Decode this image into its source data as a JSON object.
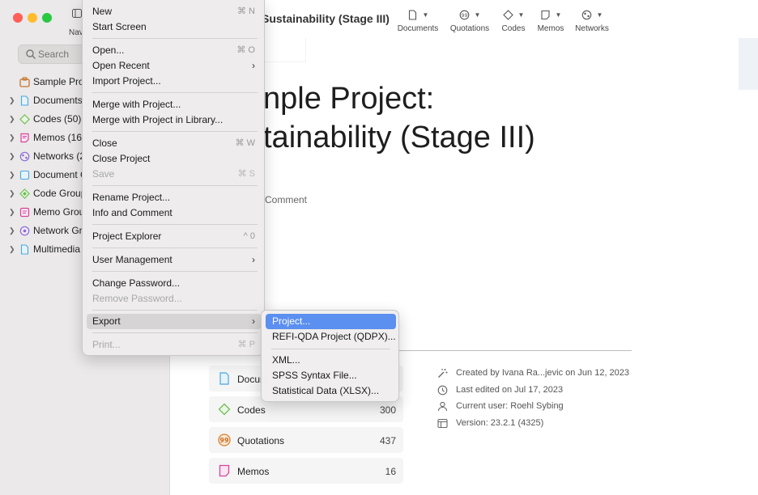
{
  "sidebar": {
    "nav_label": "Navi",
    "search_placeholder": "Search",
    "items": [
      {
        "label": "Sample Pro",
        "icon": "project-icon",
        "color": "#c8742c"
      },
      {
        "label": "Documents",
        "icon": "document-icon",
        "color": "#4aa8e0"
      },
      {
        "label": "Codes (50)",
        "icon": "code-icon",
        "color": "#6cbf4f"
      },
      {
        "label": "Memos (16)",
        "icon": "memo-icon",
        "color": "#d6449a"
      },
      {
        "label": "Networks (2",
        "icon": "network-icon",
        "color": "#8a6ad6"
      },
      {
        "label": "Document G",
        "icon": "document-group-icon",
        "color": "#4aa8e0"
      },
      {
        "label": "Code Group",
        "icon": "code-group-icon",
        "color": "#6cbf4f"
      },
      {
        "label": "Memo Grou",
        "icon": "memo-group-icon",
        "color": "#d6449a"
      },
      {
        "label": "Network Gr",
        "icon": "network-group-icon",
        "color": "#8a6ad6"
      },
      {
        "label": "Multimedia",
        "icon": "multimedia-icon",
        "color": "#4aa8e0"
      }
    ]
  },
  "toolbar": {
    "title": "Sustainability (Stage III)",
    "buttons": [
      {
        "label": "Documents",
        "icon": "document-icon"
      },
      {
        "label": "Quotations",
        "icon": "quotation-icon"
      },
      {
        "label": "Codes",
        "icon": "code-icon"
      },
      {
        "label": "Memos",
        "icon": "memo-icon"
      },
      {
        "label": "Networks",
        "icon": "network-icon"
      }
    ]
  },
  "main": {
    "title_line1": "nple Project:",
    "title_line2": "tainability (Stage III)",
    "info_comment": "Comment",
    "stats": [
      {
        "name": "Docum",
        "count": "",
        "icon": "document-icon"
      },
      {
        "name": "Codes",
        "count": "300",
        "icon": "code-icon"
      },
      {
        "name": "Quotations",
        "count": "437",
        "icon": "quotation-icon"
      },
      {
        "name": "Memos",
        "count": "16",
        "icon": "memo-icon"
      }
    ],
    "meta": {
      "created": "Created by Ivana Ra...jevic on Jun 12, 2023",
      "edited": "Last edited on Jul 17, 2023",
      "user": "Current user: Roehl Sybing",
      "version": "Version: 23.2.1 (4325)"
    }
  },
  "file_menu": {
    "new": "New",
    "new_sc": "⌘ N",
    "start_screen": "Start Screen",
    "open": "Open...",
    "open_sc": "⌘ O",
    "open_recent": "Open Recent",
    "import_project": "Import Project...",
    "merge": "Merge with Project...",
    "merge_library": "Merge with Project in Library...",
    "close": "Close",
    "close_sc": "⌘ W",
    "close_project": "Close Project",
    "save": "Save",
    "save_sc": "⌘ S",
    "rename": "Rename Project...",
    "info_comment": "Info and Comment",
    "explorer": "Project Explorer",
    "explorer_sc": "^ 0",
    "user_management": "User Management",
    "change_password": "Change Password...",
    "remove_password": "Remove Password...",
    "export": "Export",
    "print": "Print...",
    "print_sc": "⌘ P"
  },
  "export_menu": {
    "project": "Project...",
    "qdpx": "REFI-QDA Project (QDPX)...",
    "xml": "XML...",
    "spss": "SPSS Syntax File...",
    "xlsx": "Statistical Data (XLSX)..."
  }
}
